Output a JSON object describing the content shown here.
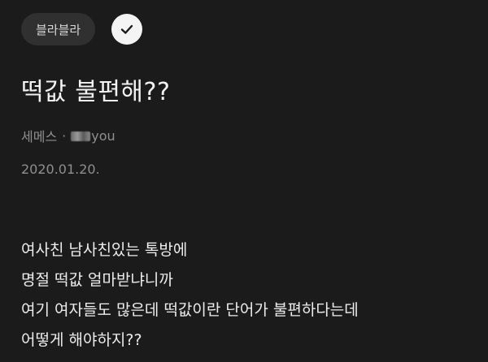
{
  "post": {
    "topic": "블라블라",
    "title": "떡값 불편해??",
    "author": {
      "company": "세메스",
      "separator": "·",
      "nickname_visible": "you"
    },
    "date": "2020.01.20.",
    "body_lines": [
      "여사친 남사친있는 톡방에",
      "명절 떡값 얼마받냐니까",
      "여기 여자들도 많은데 떡값이란 단어가 불편하다는데",
      "어떻게 해야하지??"
    ]
  },
  "icons": {
    "verified": "check-circle-icon"
  }
}
